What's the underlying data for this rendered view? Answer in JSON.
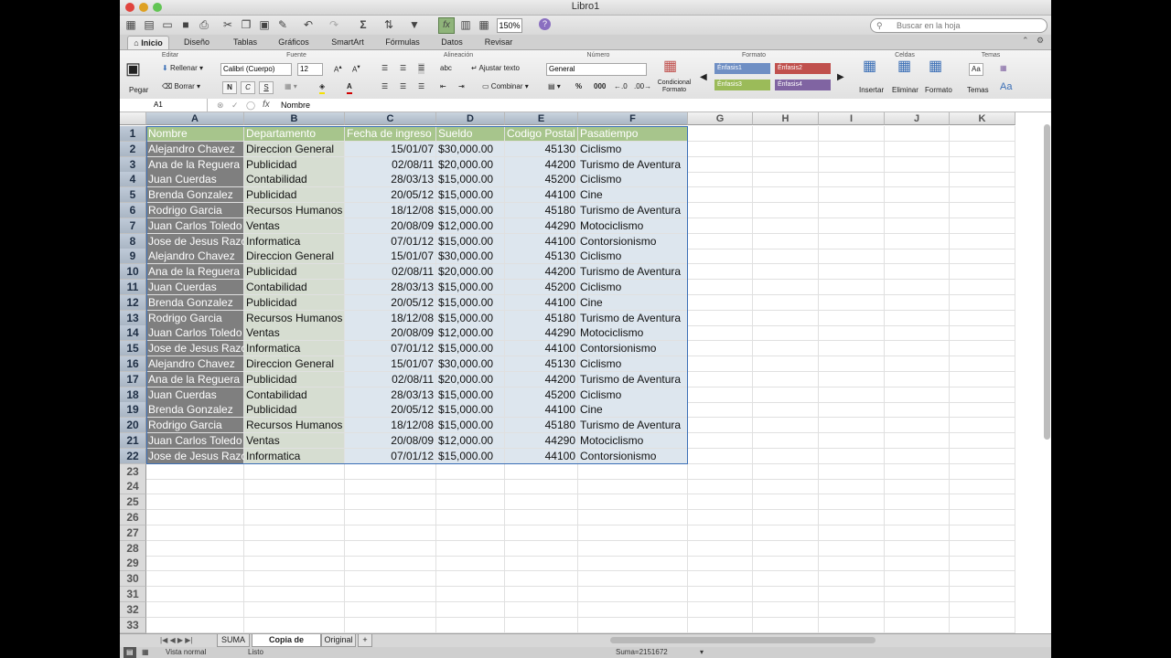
{
  "window": {
    "title": "Libro1"
  },
  "toolbar": {
    "zoom": "150%",
    "search_placeholder": "Buscar en la hoja"
  },
  "tabs": [
    "Inicio",
    "Diseño",
    "Tablas",
    "Gráficos",
    "SmartArt",
    "Fórmulas",
    "Datos",
    "Revisar"
  ],
  "ribbon": {
    "groups": {
      "editar": "Editar",
      "fuente": "Fuente",
      "alineacion": "Alineación",
      "numero": "Número",
      "formato": "Formato",
      "celdas": "Celdas",
      "temas": "Temas"
    },
    "pegar": "Pegar",
    "rellenar": "Rellenar",
    "borrar": "Borrar",
    "font": "Calibri (Cuerpo)",
    "size": "12",
    "bold": "N",
    "italic": "C",
    "underline": "S",
    "ajustar": "Ajustar texto",
    "combinar": "Combinar",
    "abc": "abc",
    "number_format": "General",
    "percent": "%",
    "thousands": "000",
    "condicional": "Condicional",
    "formato_lbl": "Formato",
    "styles": [
      "Énfasis1",
      "Énfasis2",
      "Énfasis3",
      "Énfasis4"
    ],
    "insertar": "Insertar",
    "eliminar": "Eliminar",
    "formato_btn": "Formato",
    "temas_btn": "Temas"
  },
  "formula_bar": {
    "cell_ref": "A1",
    "fx": "fx",
    "value": "Nombre"
  },
  "columns": [
    "A",
    "B",
    "C",
    "D",
    "E",
    "F",
    "G",
    "H",
    "I",
    "J",
    "K"
  ],
  "header_row": [
    "Nombre",
    "Departamento",
    "Fecha de ingreso",
    "Sueldo",
    "Codigo Postal",
    "Pasatiempo"
  ],
  "rows": [
    [
      "Alejandro Chavez",
      "Direccion General",
      "15/01/07",
      "$30,000.00",
      "45130",
      "Ciclismo"
    ],
    [
      "Ana de la Reguera",
      "Publicidad",
      "02/08/11",
      "$20,000.00",
      "44200",
      "Turismo de Aventura"
    ],
    [
      "Juan Cuerdas",
      "Contabilidad",
      "28/03/13",
      "$15,000.00",
      "45200",
      "Ciclismo"
    ],
    [
      "Brenda Gonzalez",
      "Publicidad",
      "20/05/12",
      "$15,000.00",
      "44100",
      "Cine"
    ],
    [
      "Rodrigo Garcia",
      "Recursos Humanos",
      "18/12/08",
      "$15,000.00",
      "45180",
      "Turismo de Aventura"
    ],
    [
      "Juan Carlos Toledo",
      "Ventas",
      "20/08/09",
      "$12,000.00",
      "44290",
      "Motociclismo"
    ],
    [
      "Jose de Jesus Razo",
      "Informatica",
      "07/01/12",
      "$15,000.00",
      "44100",
      "Contorsionismo"
    ],
    [
      "Alejandro Chavez",
      "Direccion General",
      "15/01/07",
      "$30,000.00",
      "45130",
      "Ciclismo"
    ],
    [
      "Ana de la Reguera",
      "Publicidad",
      "02/08/11",
      "$20,000.00",
      "44200",
      "Turismo de Aventura"
    ],
    [
      "Juan Cuerdas",
      "Contabilidad",
      "28/03/13",
      "$15,000.00",
      "45200",
      "Ciclismo"
    ],
    [
      "Brenda Gonzalez",
      "Publicidad",
      "20/05/12",
      "$15,000.00",
      "44100",
      "Cine"
    ],
    [
      "Rodrigo Garcia",
      "Recursos Humanos",
      "18/12/08",
      "$15,000.00",
      "45180",
      "Turismo de Aventura"
    ],
    [
      "Juan Carlos Toledo",
      "Ventas",
      "20/08/09",
      "$12,000.00",
      "44290",
      "Motociclismo"
    ],
    [
      "Jose de Jesus Razo",
      "Informatica",
      "07/01/12",
      "$15,000.00",
      "44100",
      "Contorsionismo"
    ],
    [
      "Alejandro Chavez",
      "Direccion General",
      "15/01/07",
      "$30,000.00",
      "45130",
      "Ciclismo"
    ],
    [
      "Ana de la Reguera",
      "Publicidad",
      "02/08/11",
      "$20,000.00",
      "44200",
      "Turismo de Aventura"
    ],
    [
      "Juan Cuerdas",
      "Contabilidad",
      "28/03/13",
      "$15,000.00",
      "45200",
      "Ciclismo"
    ],
    [
      "Brenda Gonzalez",
      "Publicidad",
      "20/05/12",
      "$15,000.00",
      "44100",
      "Cine"
    ],
    [
      "Rodrigo Garcia",
      "Recursos Humanos",
      "18/12/08",
      "$15,000.00",
      "45180",
      "Turismo de Aventura"
    ],
    [
      "Juan Carlos Toledo",
      "Ventas",
      "20/08/09",
      "$12,000.00",
      "44290",
      "Motociclismo"
    ],
    [
      "Jose de Jesus Razo",
      "Informatica",
      "07/01/12",
      "$15,000.00",
      "44100",
      "Contorsionismo"
    ]
  ],
  "row_numbers": [
    "1",
    "2",
    "3",
    "4",
    "5",
    "6",
    "7",
    "8",
    "9",
    "10",
    "11",
    "12",
    "13",
    "14",
    "15",
    "16",
    "17",
    "18",
    "19",
    "20",
    "21",
    "22",
    "23",
    "24",
    "25",
    "26",
    "27",
    "28",
    "29",
    "30",
    "31",
    "32",
    "33"
  ],
  "sheets": [
    "SUMA",
    "Copia de Original",
    "Original",
    "+"
  ],
  "active_sheet": "Copia de Original",
  "status": {
    "view": "Vista normal",
    "ready": "Listo",
    "sum": "Suma=2151672"
  },
  "colors": {
    "header_green": "#a7c58c",
    "name_gray": "#7f7f7f",
    "dept_green": "#d6ddd1",
    "body_blue": "#dde6ee",
    "accent1": "#6f8fc4",
    "accent2": "#c0504d",
    "accent3": "#9bbb59",
    "accent4": "#8064a2"
  }
}
